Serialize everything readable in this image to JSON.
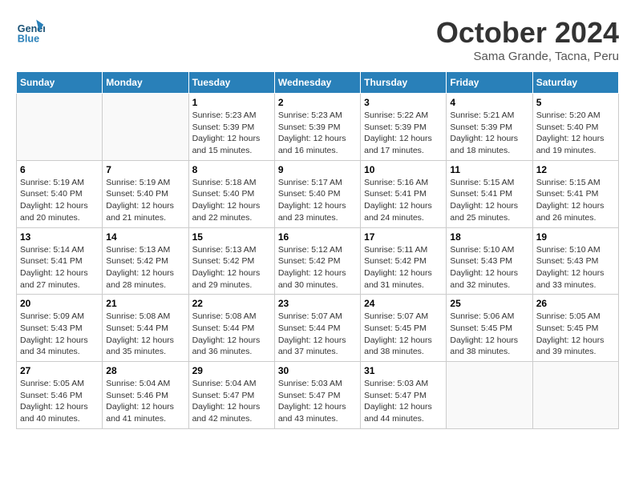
{
  "header": {
    "logo_general": "General",
    "logo_blue": "Blue",
    "month_title": "October 2024",
    "location": "Sama Grande, Tacna, Peru"
  },
  "days_of_week": [
    "Sunday",
    "Monday",
    "Tuesday",
    "Wednesday",
    "Thursday",
    "Friday",
    "Saturday"
  ],
  "weeks": [
    [
      {
        "day": "",
        "info": ""
      },
      {
        "day": "",
        "info": ""
      },
      {
        "day": "1",
        "sunrise": "5:23 AM",
        "sunset": "5:39 PM",
        "daylight": "12 hours and 15 minutes."
      },
      {
        "day": "2",
        "sunrise": "5:23 AM",
        "sunset": "5:39 PM",
        "daylight": "12 hours and 16 minutes."
      },
      {
        "day": "3",
        "sunrise": "5:22 AM",
        "sunset": "5:39 PM",
        "daylight": "12 hours and 17 minutes."
      },
      {
        "day": "4",
        "sunrise": "5:21 AM",
        "sunset": "5:39 PM",
        "daylight": "12 hours and 18 minutes."
      },
      {
        "day": "5",
        "sunrise": "5:20 AM",
        "sunset": "5:40 PM",
        "daylight": "12 hours and 19 minutes."
      }
    ],
    [
      {
        "day": "6",
        "sunrise": "5:19 AM",
        "sunset": "5:40 PM",
        "daylight": "12 hours and 20 minutes."
      },
      {
        "day": "7",
        "sunrise": "5:19 AM",
        "sunset": "5:40 PM",
        "daylight": "12 hours and 21 minutes."
      },
      {
        "day": "8",
        "sunrise": "5:18 AM",
        "sunset": "5:40 PM",
        "daylight": "12 hours and 22 minutes."
      },
      {
        "day": "9",
        "sunrise": "5:17 AM",
        "sunset": "5:40 PM",
        "daylight": "12 hours and 23 minutes."
      },
      {
        "day": "10",
        "sunrise": "5:16 AM",
        "sunset": "5:41 PM",
        "daylight": "12 hours and 24 minutes."
      },
      {
        "day": "11",
        "sunrise": "5:15 AM",
        "sunset": "5:41 PM",
        "daylight": "12 hours and 25 minutes."
      },
      {
        "day": "12",
        "sunrise": "5:15 AM",
        "sunset": "5:41 PM",
        "daylight": "12 hours and 26 minutes."
      }
    ],
    [
      {
        "day": "13",
        "sunrise": "5:14 AM",
        "sunset": "5:41 PM",
        "daylight": "12 hours and 27 minutes."
      },
      {
        "day": "14",
        "sunrise": "5:13 AM",
        "sunset": "5:42 PM",
        "daylight": "12 hours and 28 minutes."
      },
      {
        "day": "15",
        "sunrise": "5:13 AM",
        "sunset": "5:42 PM",
        "daylight": "12 hours and 29 minutes."
      },
      {
        "day": "16",
        "sunrise": "5:12 AM",
        "sunset": "5:42 PM",
        "daylight": "12 hours and 30 minutes."
      },
      {
        "day": "17",
        "sunrise": "5:11 AM",
        "sunset": "5:42 PM",
        "daylight": "12 hours and 31 minutes."
      },
      {
        "day": "18",
        "sunrise": "5:10 AM",
        "sunset": "5:43 PM",
        "daylight": "12 hours and 32 minutes."
      },
      {
        "day": "19",
        "sunrise": "5:10 AM",
        "sunset": "5:43 PM",
        "daylight": "12 hours and 33 minutes."
      }
    ],
    [
      {
        "day": "20",
        "sunrise": "5:09 AM",
        "sunset": "5:43 PM",
        "daylight": "12 hours and 34 minutes."
      },
      {
        "day": "21",
        "sunrise": "5:08 AM",
        "sunset": "5:44 PM",
        "daylight": "12 hours and 35 minutes."
      },
      {
        "day": "22",
        "sunrise": "5:08 AM",
        "sunset": "5:44 PM",
        "daylight": "12 hours and 36 minutes."
      },
      {
        "day": "23",
        "sunrise": "5:07 AM",
        "sunset": "5:44 PM",
        "daylight": "12 hours and 37 minutes."
      },
      {
        "day": "24",
        "sunrise": "5:07 AM",
        "sunset": "5:45 PM",
        "daylight": "12 hours and 38 minutes."
      },
      {
        "day": "25",
        "sunrise": "5:06 AM",
        "sunset": "5:45 PM",
        "daylight": "12 hours and 38 minutes."
      },
      {
        "day": "26",
        "sunrise": "5:05 AM",
        "sunset": "5:45 PM",
        "daylight": "12 hours and 39 minutes."
      }
    ],
    [
      {
        "day": "27",
        "sunrise": "5:05 AM",
        "sunset": "5:46 PM",
        "daylight": "12 hours and 40 minutes."
      },
      {
        "day": "28",
        "sunrise": "5:04 AM",
        "sunset": "5:46 PM",
        "daylight": "12 hours and 41 minutes."
      },
      {
        "day": "29",
        "sunrise": "5:04 AM",
        "sunset": "5:47 PM",
        "daylight": "12 hours and 42 minutes."
      },
      {
        "day": "30",
        "sunrise": "5:03 AM",
        "sunset": "5:47 PM",
        "daylight": "12 hours and 43 minutes."
      },
      {
        "day": "31",
        "sunrise": "5:03 AM",
        "sunset": "5:47 PM",
        "daylight": "12 hours and 44 minutes."
      },
      {
        "day": "",
        "info": ""
      },
      {
        "day": "",
        "info": ""
      }
    ]
  ]
}
